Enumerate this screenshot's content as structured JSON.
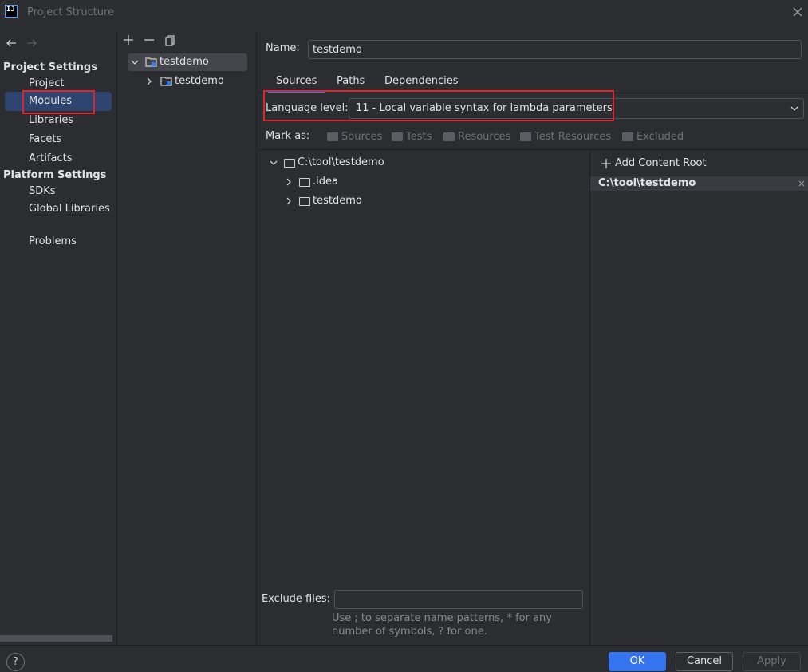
{
  "window": {
    "title": "Project Structure",
    "app_icon_text": "IJ"
  },
  "nav": {
    "project_settings_heading": "Project Settings",
    "project_items": [
      "Project",
      "Modules",
      "Libraries",
      "Facets",
      "Artifacts"
    ],
    "platform_settings_heading": "Platform Settings",
    "platform_items": [
      "SDKs",
      "Global Libraries"
    ],
    "problems": "Problems",
    "selected": "Modules"
  },
  "module_tree": {
    "root": "testdemo",
    "child": "testdemo"
  },
  "module": {
    "name_label": "Name:",
    "name_value": "testdemo",
    "tabs": [
      "Sources",
      "Paths",
      "Dependencies"
    ],
    "active_tab": "Sources",
    "language_level_label": "Language level:",
    "language_level_value": "11 - Local variable syntax for lambda parameters",
    "mark_as_label": "Mark as:",
    "mark_as_options": [
      "Sources",
      "Tests",
      "Resources",
      "Test Resources",
      "Excluded"
    ],
    "file_tree": {
      "root": "C:\\tool\\testdemo",
      "children": [
        ".idea",
        "testdemo"
      ]
    },
    "add_content_root": "Add Content Root",
    "content_root_path": "C:\\tool\\testdemo",
    "exclude_files_label": "Exclude files:",
    "exclude_files_value": "",
    "exclude_hint_line1": "Use ; to separate name patterns, * for any",
    "exclude_hint_line2": "number of symbols, ? for one."
  },
  "buttons": {
    "ok": "OK",
    "cancel": "Cancel",
    "apply": "Apply",
    "help": "?"
  },
  "colors": {
    "accent": "#3574f0",
    "highlight_box": "#e0242b",
    "selection": "#2e436e"
  }
}
